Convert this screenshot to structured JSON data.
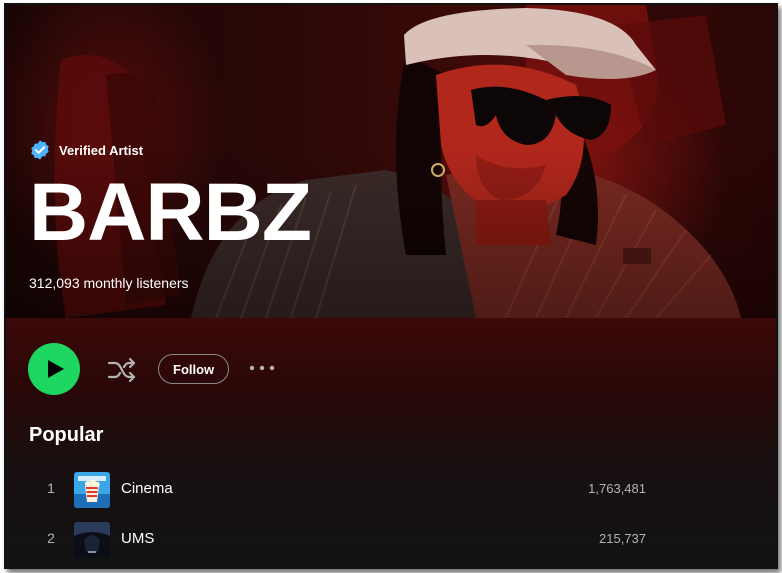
{
  "artist": {
    "verified_label": "Verified Artist",
    "name": "BARBZ",
    "monthly_listeners": "312,093 monthly listeners"
  },
  "actions": {
    "play_icon": "play-icon",
    "shuffle_icon": "shuffle-icon",
    "follow_label": "Follow",
    "more_icon": "more-options-icon"
  },
  "popular": {
    "title": "Popular",
    "tracks": [
      {
        "number": "1",
        "title": "Cinema",
        "plays": "1,763,481"
      },
      {
        "number": "2",
        "title": "UMS",
        "plays": "215,737"
      }
    ]
  },
  "colors": {
    "accent_green": "#1ed760",
    "verified_blue": "#4cb3ff",
    "background": "#121212",
    "hero_red": "#8e1410"
  }
}
